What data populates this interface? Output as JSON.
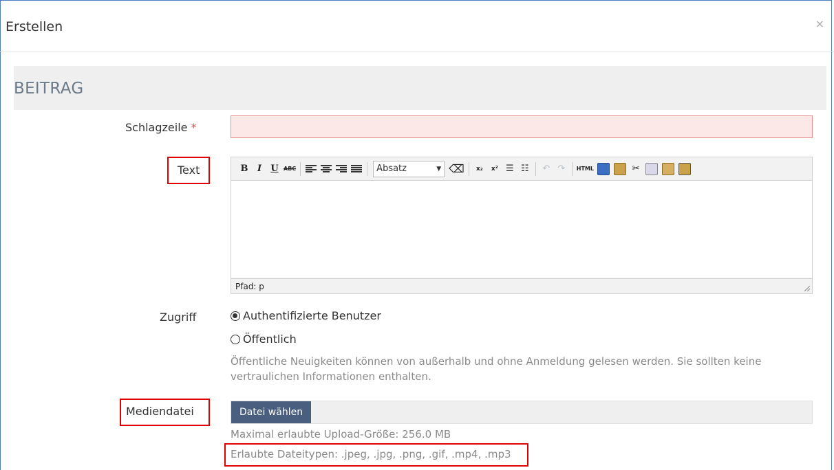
{
  "modal": {
    "title": "Erstellen",
    "close": "×"
  },
  "section": {
    "title": "BEITRAG"
  },
  "fields": {
    "headline": {
      "label": "Schlagzeile",
      "required": "*",
      "value": ""
    },
    "text": {
      "label": "Text"
    },
    "access": {
      "label": "Zugriff",
      "options": [
        {
          "label": "Authentifizierte Benutzer",
          "selected": true
        },
        {
          "label": "Öffentlich",
          "selected": false
        }
      ],
      "help": "Öffentliche Neuigkeiten können von außerhalb und ohne Anmeldung gelesen werden. Sie sollten keine vertraulichen Informationen enthalten."
    },
    "media": {
      "label": "Mediendatei",
      "button": "Datei wählen",
      "max_size": "Maximal erlaubte Upload-Größe: 256.0 MB",
      "types": "Erlaubte Dateitypen: .jpeg, .jpg, .png, .gif, .mp4, .mp3"
    }
  },
  "editor": {
    "toolbar": {
      "bold": "B",
      "italic": "I",
      "underline": "U",
      "strike": "ABC",
      "format": "Absatz",
      "subscript": "x₂",
      "superscript": "x²",
      "html": "HTML"
    },
    "path": "Pfad: p"
  },
  "colors": {
    "required": "#d9534f",
    "highlight": "#e00000",
    "button": "#4a5f80",
    "invalid_bg": "#fde8e8"
  }
}
